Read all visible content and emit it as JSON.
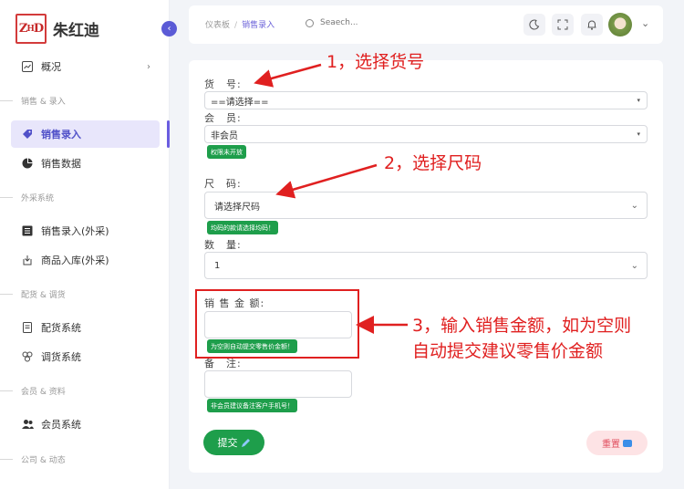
{
  "brand": {
    "logo_mark": "ZₓD",
    "name": "朱红迪"
  },
  "sidebar": {
    "items": [
      {
        "label": "概况",
        "icon": "chart-icon"
      },
      {
        "label": "销售录入",
        "icon": "tag-icon",
        "active": true
      },
      {
        "label": "销售数据",
        "icon": "pie-icon"
      },
      {
        "label": "销售录入(外采)",
        "icon": "list-icon"
      },
      {
        "label": "商品入库(外采)",
        "icon": "import-icon"
      },
      {
        "label": "配货系统",
        "icon": "document-icon"
      },
      {
        "label": "调货系统",
        "icon": "exchange-icon"
      },
      {
        "label": "会员系统",
        "icon": "users-icon"
      }
    ],
    "sections": [
      "销售 & 录入",
      "外采系统",
      "配货 & 调货",
      "会员 & 资料",
      "公司 & 动态"
    ]
  },
  "header": {
    "breadcrumb": [
      "仪表板",
      "销售录入"
    ],
    "search_placeholder": "Seaech..."
  },
  "form": {
    "item_no": {
      "label": "货　号:",
      "value": "==请选择=="
    },
    "member": {
      "label": "会　员:",
      "value": "非会员",
      "hint": "权限未开放"
    },
    "size": {
      "label": "尺　码:",
      "value": "请选择尺码",
      "hint": "均码的款请选择均码！"
    },
    "qty": {
      "label": "数　量:",
      "value": "1"
    },
    "amount": {
      "label": "销 售 金 额:",
      "value": "",
      "hint": "为空则自动提交零售价金额！"
    },
    "note": {
      "label": "备　注:",
      "value": "",
      "hint": "非会员建议备注客户手机号！"
    },
    "submit_label": "提交",
    "reset_label": "重置"
  },
  "annotations": {
    "a1": "1，选择货号",
    "a2": "2，选择尺码",
    "a3_line1": "3，输入销售金额，如为空则",
    "a3_line2": "自动提交建议零售价金额"
  },
  "colors": {
    "accent": "#6a5de0",
    "success": "#1e9e4b",
    "annotation": "#e02020"
  }
}
